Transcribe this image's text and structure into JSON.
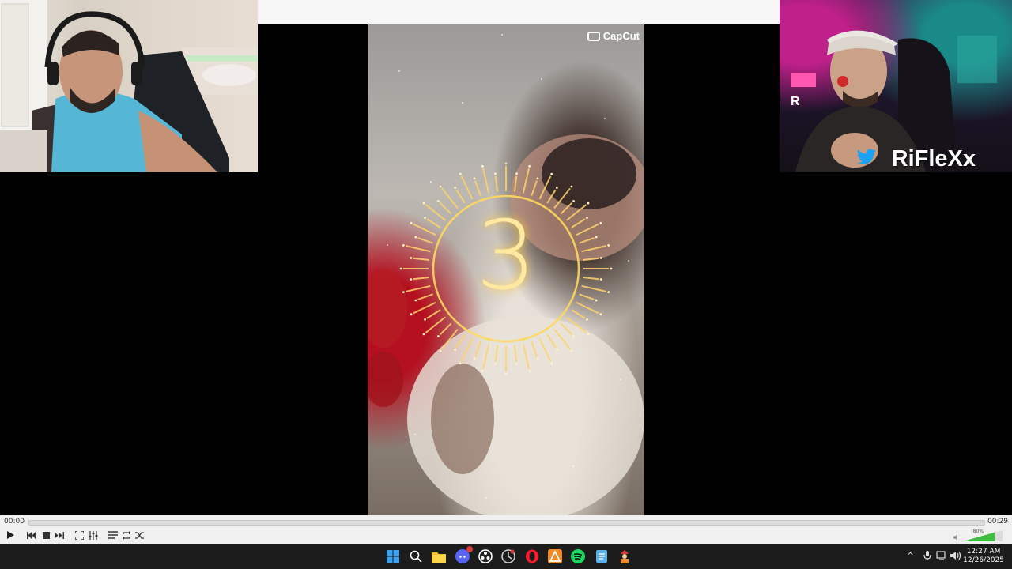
{
  "video": {
    "watermark": "CapCut",
    "countdown_number": "3"
  },
  "webcam_right": {
    "streamer_name": "RiFleXx",
    "corner_letter": "R"
  },
  "player": {
    "time_current": "00:00",
    "time_total": "00:29",
    "volume_percent": "80%",
    "seek_progress": 0,
    "volume_level": 0.8
  },
  "taskbar": {
    "apps": [
      "windows-start",
      "search",
      "file-explorer",
      "discord",
      "obs",
      "app-circle",
      "opera",
      "app-triangle",
      "spotify",
      "notepad",
      "app-figure"
    ],
    "clock_time": "12:27 AM",
    "clock_date": "12/26/2025",
    "discord_badge_color": "#e03a3a"
  },
  "colors": {
    "glow": "#ffcc44",
    "seek_track": "#dcdcdc",
    "volume_fill": "#3fbf3f"
  }
}
